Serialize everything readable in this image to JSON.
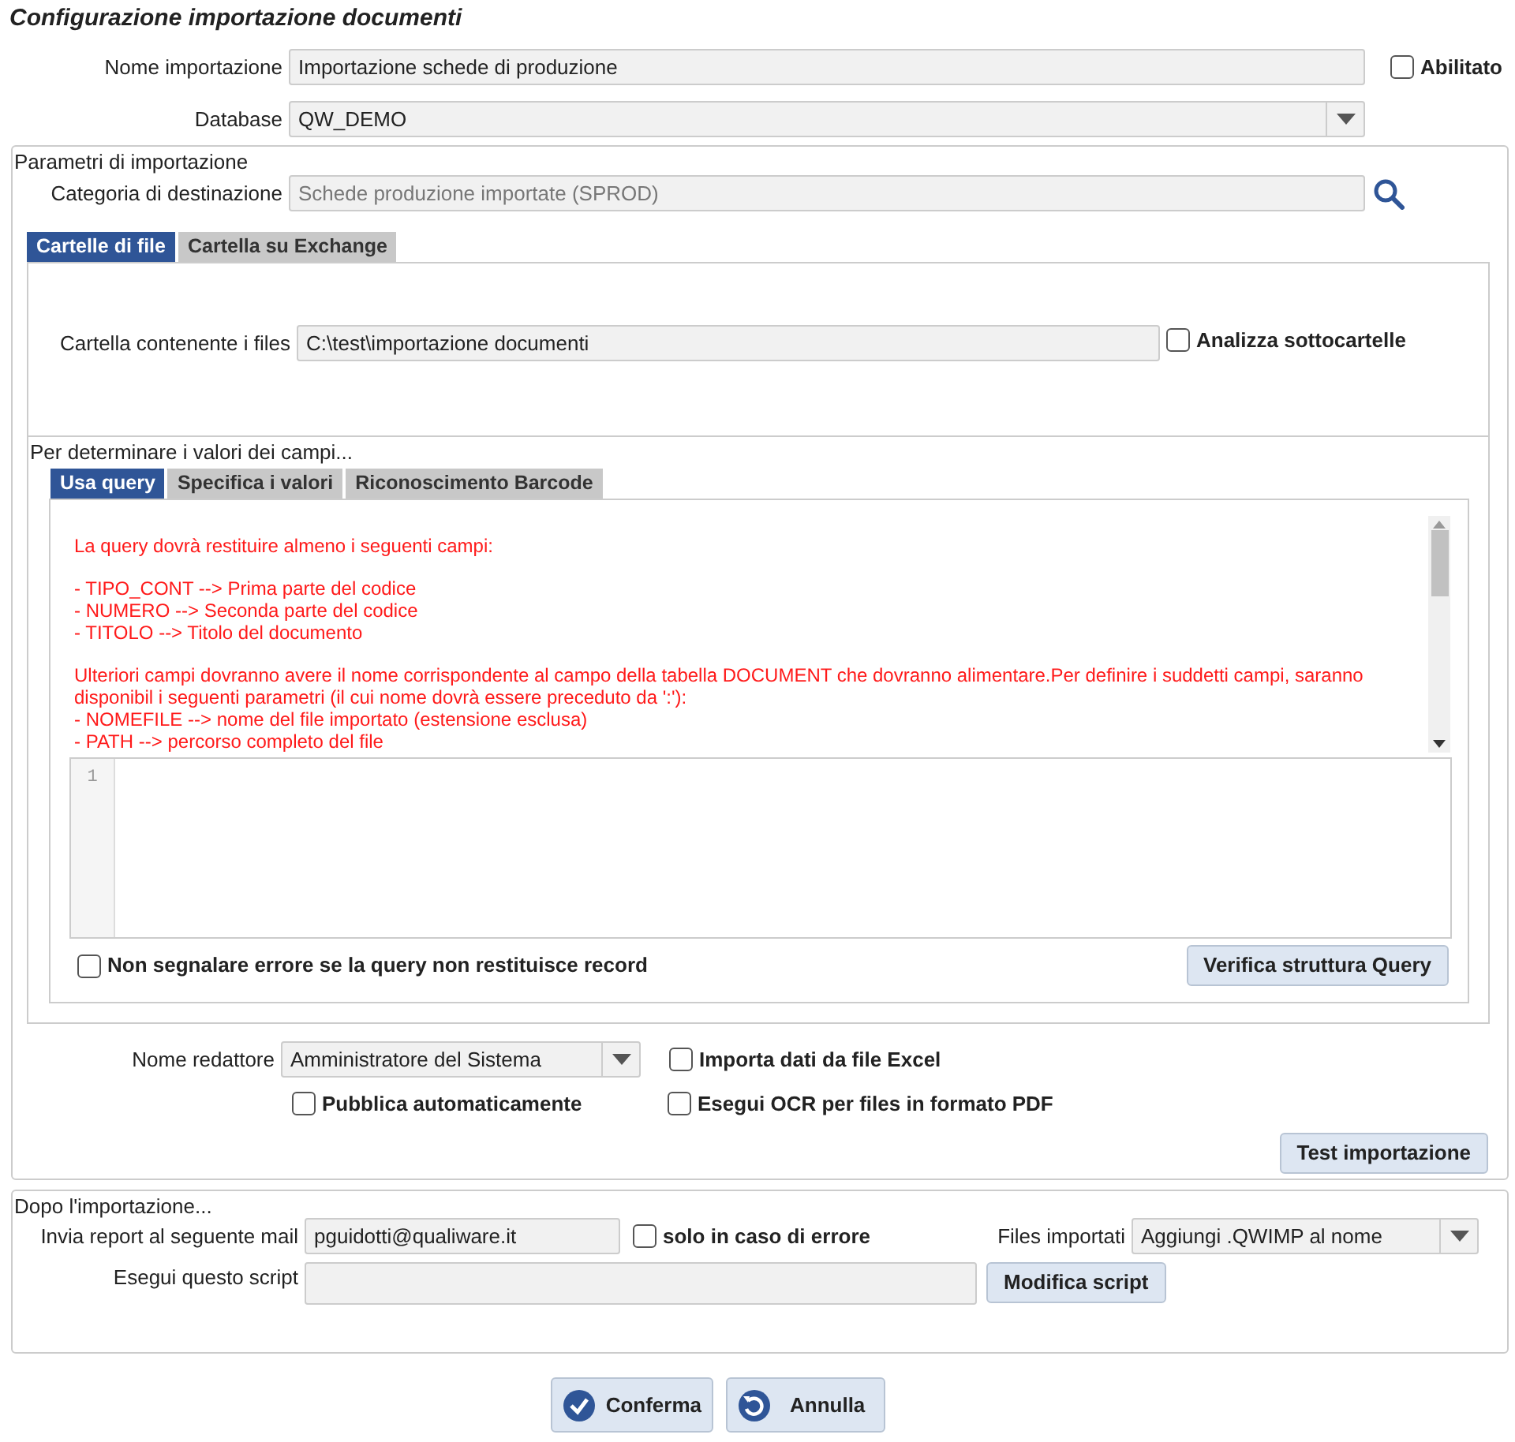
{
  "title": "Configurazione importazione documenti",
  "name_field": {
    "label": "Nome importazione",
    "value": "Importazione schede di produzione"
  },
  "enabled": {
    "label": "Abilitato",
    "checked": false
  },
  "database": {
    "label": "Database",
    "value": "QW_DEMO"
  },
  "params": {
    "legend": "Parametri di importazione",
    "category": {
      "label": "Categoria di destinazione",
      "value": "Schede produzione importate (SPROD)"
    },
    "folder_tabs": [
      {
        "label": "Cartelle di file",
        "selected": true
      },
      {
        "label": "Cartella su Exchange",
        "selected": false
      }
    ],
    "folder": {
      "label": "Cartella contenente i files",
      "value": "C:\\test\\importazione documenti"
    },
    "subfolders": {
      "label": "Analizza sottocartelle",
      "checked": false
    },
    "values": {
      "legend": "Per determinare i valori dei campi...",
      "tabs": [
        {
          "label": "Usa query",
          "selected": true
        },
        {
          "label": "Specifica i valori",
          "selected": false
        },
        {
          "label": "Riconoscimento Barcode",
          "selected": false
        }
      ],
      "help": [
        [
          "La query dovrà restituire almeno i seguenti campi:"
        ],
        [
          "- TIPO_CONT --> Prima parte del codice",
          "- NUMERO --> Seconda parte del codice",
          "- TITOLO --> Titolo del documento"
        ],
        [
          "Ulteriori campi dovranno avere il nome corrispondente al campo della tabella DOCUMENT che dovranno alimentare.Per definire i suddetti campi, saranno disponibil i seguenti parametri (il cui nome dovrà essere preceduto da ':'):",
          "- NOMEFILE --> nome del file importato (estensione esclusa)",
          "- PATH --> percorso completo del file"
        ]
      ],
      "line_number": "1",
      "no_error": {
        "label": "Non segnalare errore se la query non restituisce record",
        "checked": false
      },
      "verify_button": "Verifica struttura Query"
    },
    "editor": {
      "label": "Nome redattore",
      "value": "Amministratore del Sistema"
    },
    "import_excel": {
      "label": "Importa dati da file Excel",
      "checked": false
    },
    "auto_publish": {
      "label": "Pubblica automaticamente",
      "checked": false
    },
    "ocr": {
      "label": "Esegui OCR per files in formato PDF",
      "checked": false
    },
    "test_button": "Test importazione"
  },
  "after": {
    "legend": "Dopo l'importazione...",
    "mail": {
      "label": "Invia report al seguente mail",
      "value": "pguidotti@qualiware.it"
    },
    "only_error": {
      "label": "solo in caso di errore",
      "checked": false
    },
    "imported_files": {
      "label": "Files importati",
      "value": "Aggiungi .QWIMP al nome"
    },
    "script": {
      "label": "Esegui questo script"
    },
    "modify_button": "Modifica script"
  },
  "buttons": [
    {
      "kind": "confirm",
      "label": "Conferma"
    },
    {
      "kind": "cancel",
      "label": "Annulla"
    }
  ]
}
